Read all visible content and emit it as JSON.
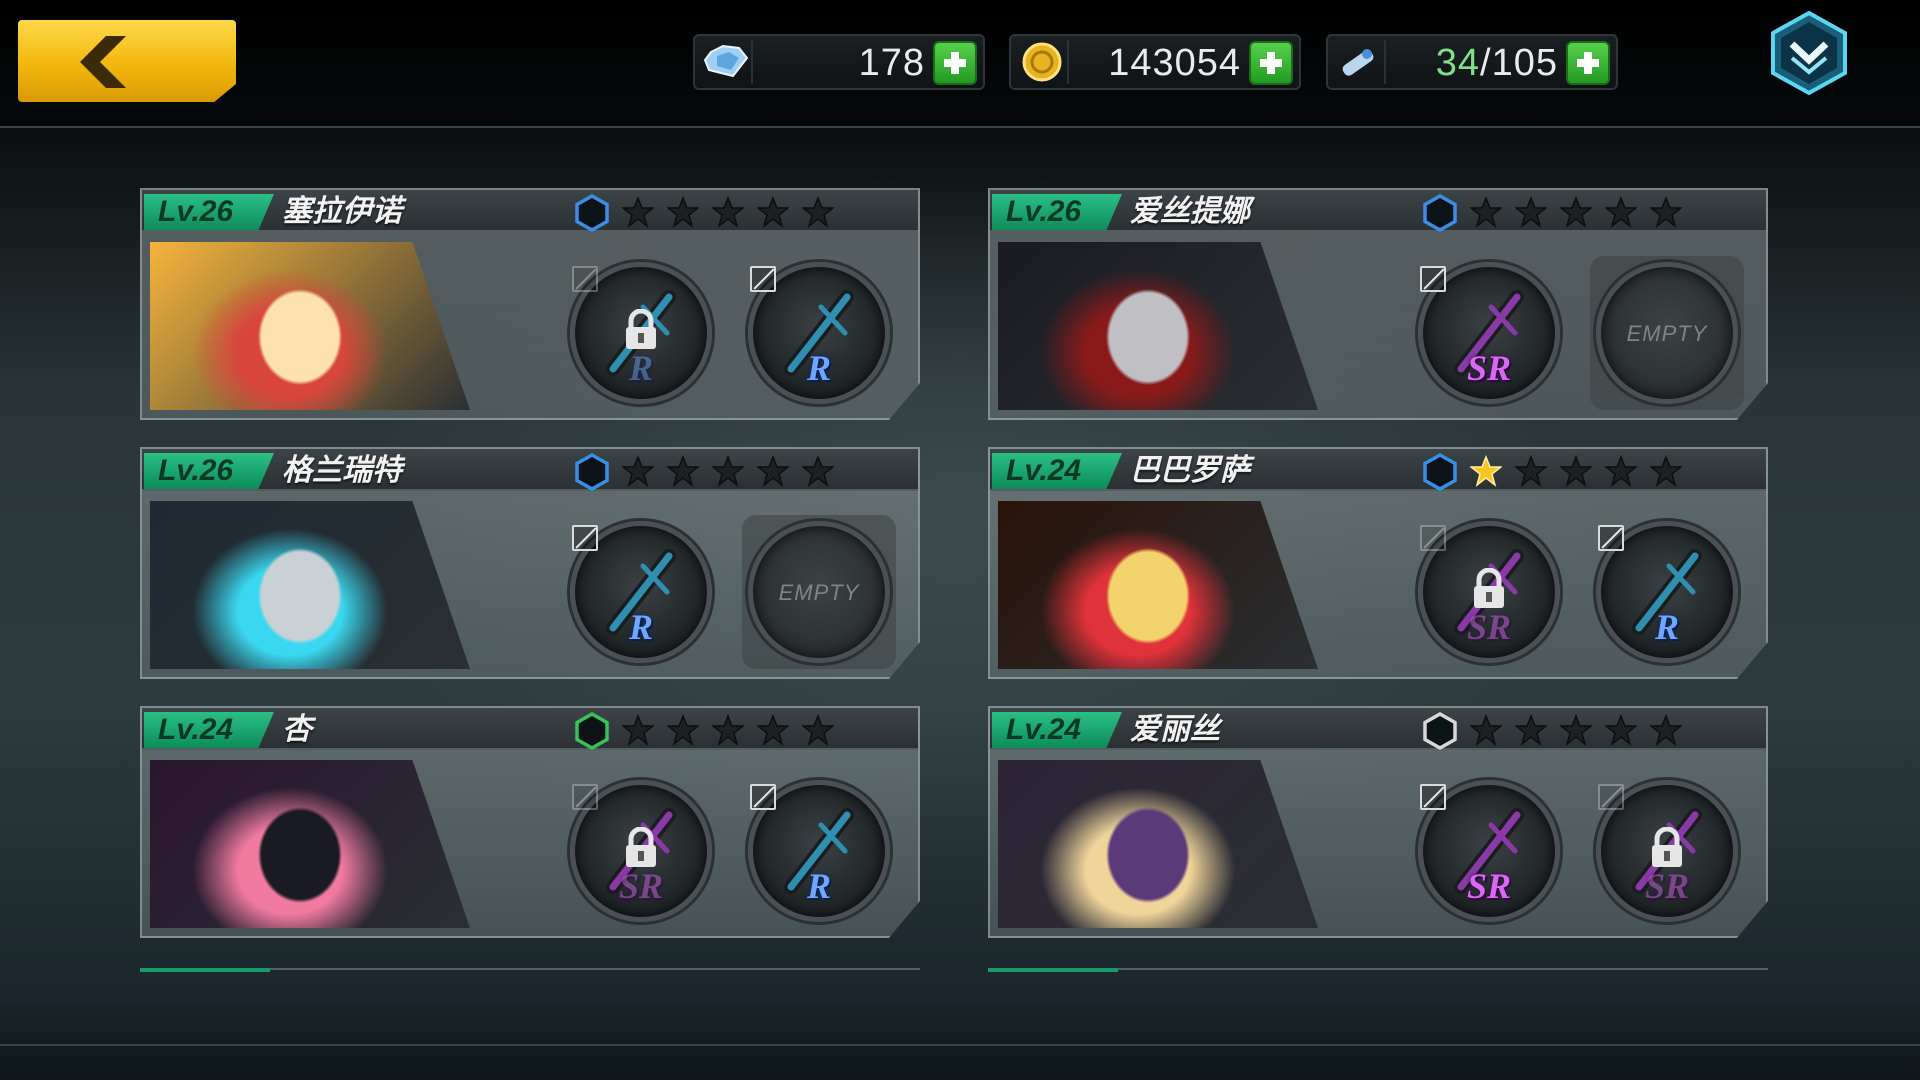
{
  "resources": {
    "gems": {
      "icon": "diamond-icon",
      "value": "178"
    },
    "gold": {
      "icon": "gold-coin-icon",
      "value": "143054"
    },
    "stamina": {
      "icon": "stamina-ticket-icon",
      "current": "34",
      "max": "/105"
    }
  },
  "icons": {
    "back": "back-arrow-icon",
    "menu": "chevron-down-menu-icon",
    "plus": "plus-icon"
  },
  "characters": [
    {
      "level": "Lv.26",
      "name": "塞拉伊诺",
      "rank_color": "#3a8ee6",
      "stars": 0,
      "slots": [
        {
          "rarity": "R",
          "locked": true
        },
        {
          "rarity": "R",
          "locked": false
        }
      ]
    },
    {
      "level": "Lv.26",
      "name": "爱丝提娜",
      "rank_color": "#3a8ee6",
      "stars": 0,
      "slots": [
        {
          "rarity": "SR",
          "locked": false
        },
        {
          "empty_label": "EMPTY"
        }
      ]
    },
    {
      "level": "Lv.26",
      "name": "格兰瑞特",
      "rank_color": "#3a8ee6",
      "stars": 0,
      "slots": [
        {
          "rarity": "R",
          "locked": false
        },
        {
          "empty_label": "EMPTY"
        }
      ]
    },
    {
      "level": "Lv.24",
      "name": "巴巴罗萨",
      "rank_color": "#3a8ee6",
      "stars": 1,
      "slots": [
        {
          "rarity": "SR",
          "locked": true
        },
        {
          "rarity": "R",
          "locked": false
        }
      ]
    },
    {
      "level": "Lv.24",
      "name": "杏",
      "rank_color": "#39c25a",
      "stars": 0,
      "slots": [
        {
          "rarity": "SR",
          "locked": true
        },
        {
          "rarity": "R",
          "locked": false
        }
      ]
    },
    {
      "level": "Lv.24",
      "name": "爱丽丝",
      "rank_color": "#d8d8d8",
      "stars": 0,
      "slots": [
        {
          "rarity": "SR",
          "locked": false
        },
        {
          "rarity": "SR",
          "locked": true
        }
      ]
    }
  ],
  "colors": {
    "level_badge": "#1aa874",
    "star_filled": "#f7c525",
    "star_empty": "#1c2022",
    "rarity_r": "#6fa6ff",
    "rarity_sr": "#d968f2"
  }
}
